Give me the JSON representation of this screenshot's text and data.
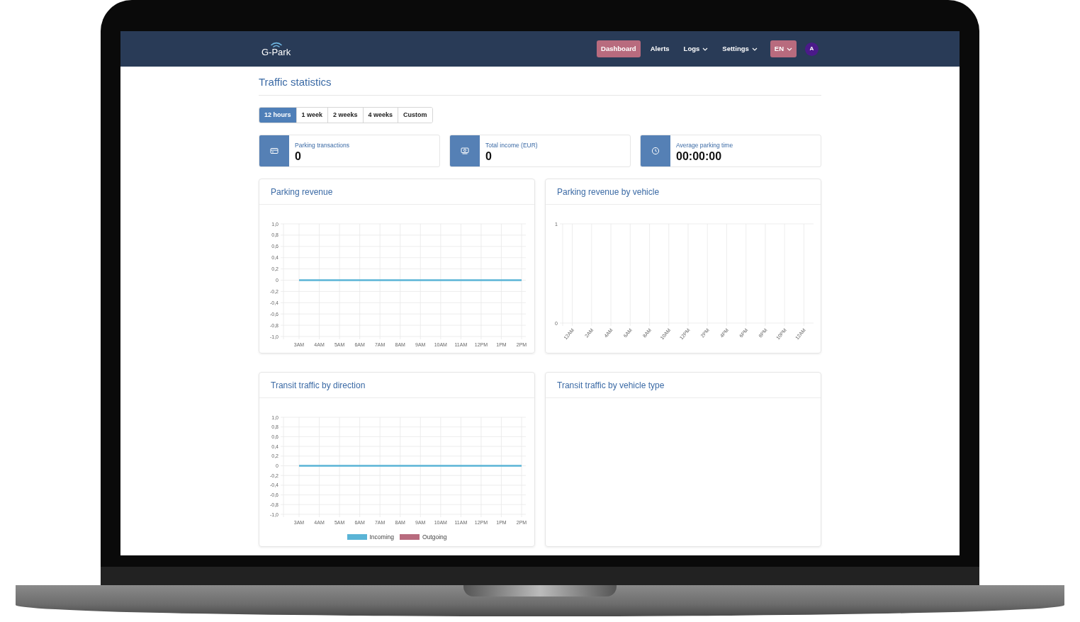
{
  "navbar": {
    "logo": "G-Park",
    "items": [
      {
        "label": "Dashboard",
        "selected": true,
        "dropdown": false
      },
      {
        "label": "Alerts",
        "selected": false,
        "dropdown": false
      },
      {
        "label": "Logs",
        "selected": false,
        "dropdown": true
      },
      {
        "label": "Settings",
        "selected": false,
        "dropdown": true
      }
    ],
    "language": "EN",
    "avatar": "A"
  },
  "page_title": "Traffic statistics",
  "periods": [
    {
      "label": "12 hours",
      "selected": true
    },
    {
      "label": "1 week",
      "selected": false
    },
    {
      "label": "2 weeks",
      "selected": false
    },
    {
      "label": "4 weeks",
      "selected": false
    },
    {
      "label": "Custom",
      "selected": false
    }
  ],
  "stats": [
    {
      "kind": "card",
      "label": "Parking transactions",
      "value": "0"
    },
    {
      "kind": "money",
      "label": "Total income (EUR)",
      "value": "0"
    },
    {
      "kind": "clock",
      "label": "Average parking time",
      "value": "00:00:00"
    }
  ],
  "charts": [
    {
      "title": "Parking revenue",
      "chart_data": {
        "type": "line",
        "categories": [
          "3AM",
          "4AM",
          "5AM",
          "6AM",
          "7AM",
          "8AM",
          "9AM",
          "10AM",
          "11AM",
          "12PM",
          "1PM",
          "2PM"
        ],
        "ylim": [
          -1,
          1
        ],
        "yticks": [
          {
            "value": 1,
            "label": "1,0"
          },
          {
            "value": 0.8,
            "label": "0,8"
          },
          {
            "value": 0.6,
            "label": "0,6"
          },
          {
            "value": 0.4,
            "label": "0,4"
          },
          {
            "value": 0.2,
            "label": "0,2"
          },
          {
            "value": 0,
            "label": "0"
          },
          {
            "value": -0.2,
            "label": "-0,2"
          },
          {
            "value": -0.4,
            "label": "-0,4"
          },
          {
            "value": -0.6,
            "label": "-0,6"
          },
          {
            "value": -0.8,
            "label": "-0,8"
          },
          {
            "value": -1,
            "label": "-1,0"
          }
        ],
        "grid": true,
        "series": [
          {
            "color": "#5ab4d6",
            "values": [
              0,
              0,
              0,
              0,
              0,
              0,
              0,
              0,
              0,
              0,
              0,
              0
            ]
          }
        ]
      }
    },
    {
      "title": "Parking revenue by vehicle",
      "chart_data": {
        "type": "bar",
        "categories": [
          "12AM",
          "2AM",
          "4AM",
          "6AM",
          "8AM",
          "10AM",
          "12PM",
          "2PM",
          "4PM",
          "6PM",
          "8PM",
          "10PM",
          "12AM"
        ],
        "ylim": [
          0,
          1
        ],
        "yticks": [
          {
            "value": 0,
            "label": "0"
          },
          {
            "value": 1,
            "label": "1"
          }
        ],
        "grid": true,
        "values": [
          0,
          0,
          0,
          0,
          0,
          0,
          0,
          0,
          0,
          0,
          0,
          0,
          0
        ]
      }
    },
    {
      "title": "Transit traffic by direction",
      "chart_data": {
        "type": "line",
        "categories": [
          "3AM",
          "4AM",
          "5AM",
          "6AM",
          "7AM",
          "8AM",
          "9AM",
          "10AM",
          "11AM",
          "12PM",
          "1PM",
          "2PM"
        ],
        "ylim": [
          -1,
          1
        ],
        "yticks": [
          {
            "value": 1,
            "label": "1,0"
          },
          {
            "value": 0.8,
            "label": "0,8"
          },
          {
            "value": 0.6,
            "label": "0,6"
          },
          {
            "value": 0.4,
            "label": "0,4"
          },
          {
            "value": 0.2,
            "label": "0,2"
          },
          {
            "value": 0,
            "label": "0"
          },
          {
            "value": -0.2,
            "label": "-0,2"
          },
          {
            "value": -0.4,
            "label": "-0,4"
          },
          {
            "value": -0.6,
            "label": "-0,6"
          },
          {
            "value": -0.8,
            "label": "-0,8"
          },
          {
            "value": -1,
            "label": "-1,0"
          }
        ],
        "grid": true,
        "series": [
          {
            "name": "Incoming",
            "color": "#5ab4d6",
            "values": [
              0,
              0,
              0,
              0,
              0,
              0,
              0,
              0,
              0,
              0,
              0,
              0
            ]
          },
          {
            "name": "Outgoing",
            "color": "#b86b7e",
            "values": [
              null,
              null,
              null,
              null,
              null,
              null,
              null,
              null,
              null,
              null,
              null,
              null
            ]
          }
        ]
      }
    },
    {
      "title": "Transit traffic by vehicle type"
    }
  ]
}
